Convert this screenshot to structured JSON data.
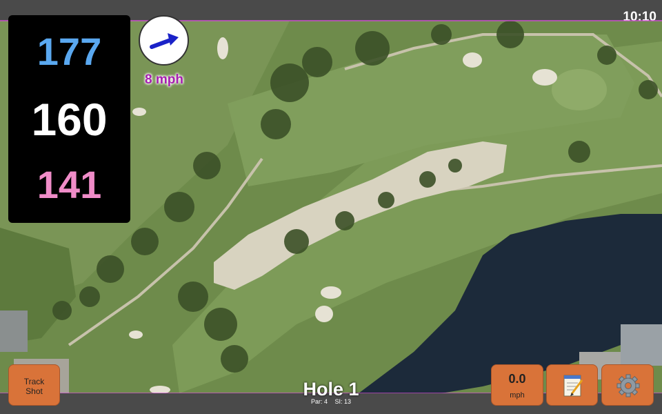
{
  "status_bar": {
    "time": "10:10"
  },
  "distances": {
    "back": "177",
    "center": "160",
    "front": "141"
  },
  "wind": {
    "speed_text": "8 mph",
    "direction_icon": "wind-arrow-icon"
  },
  "buttons": {
    "track_shot_line1": "Track",
    "track_shot_line2": "Shot",
    "wind_value": "0.0",
    "wind_unit": "mph",
    "notes_icon": "notepad-icon",
    "settings_icon": "gear-icon"
  },
  "hole": {
    "title": "Hole 1",
    "par": "Par: 4",
    "si": "SI: 13"
  },
  "colors": {
    "back_distance": "#5aa8f0",
    "center_distance": "#ffffff",
    "front_distance": "#f08cc8",
    "button_orange": "#d97339",
    "wind_text": "#a71fb0"
  }
}
